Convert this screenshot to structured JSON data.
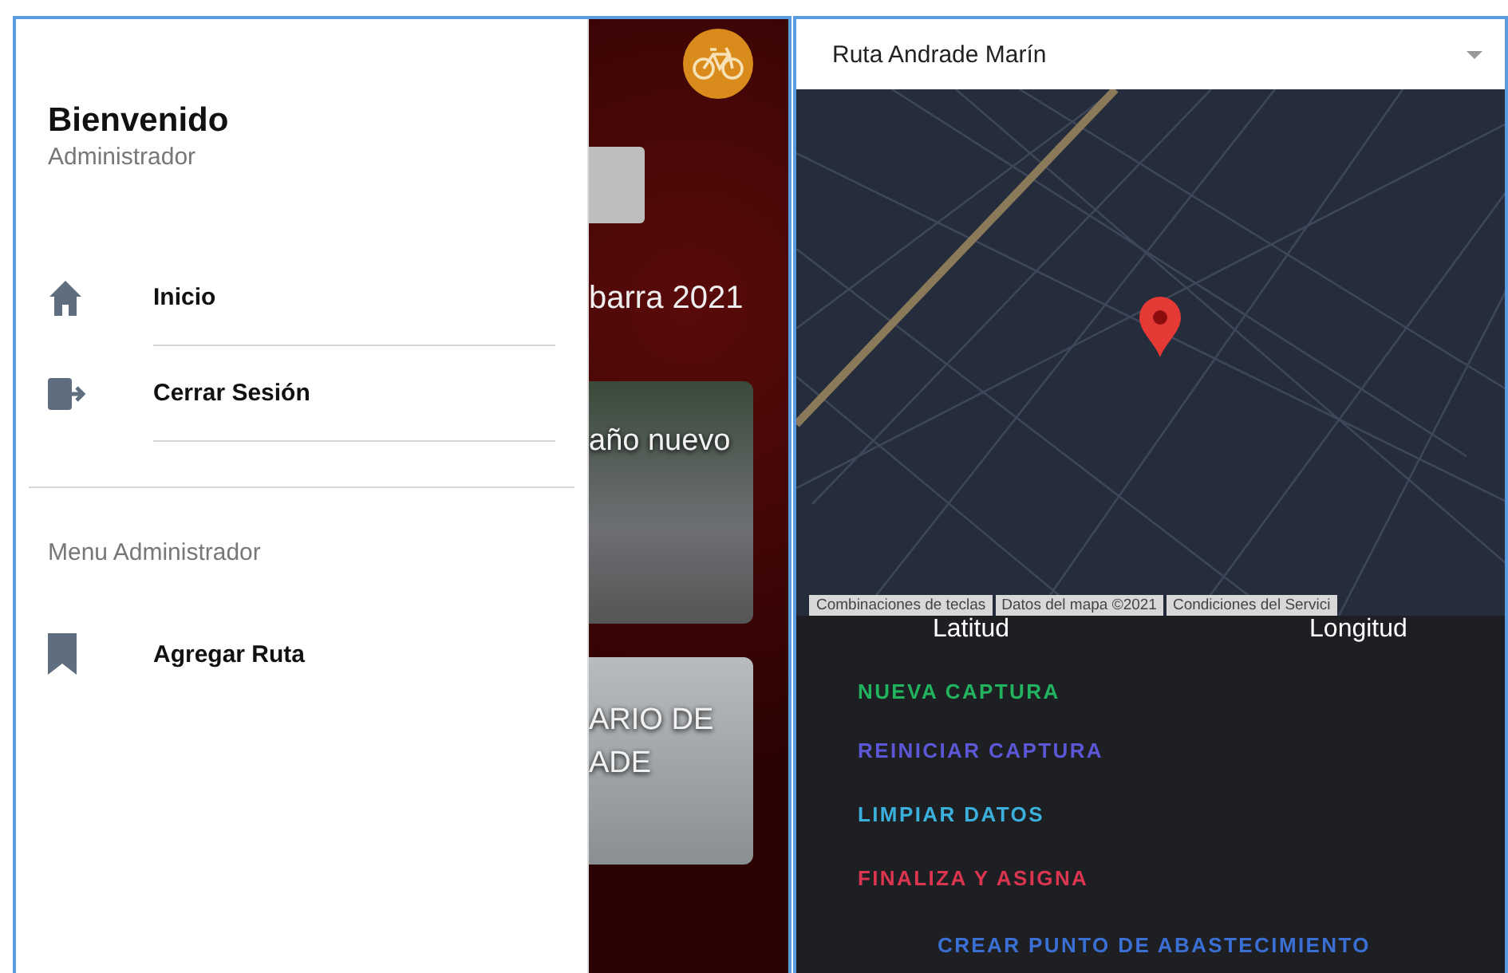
{
  "drawer": {
    "title": "Bienvenido",
    "subtitle": "Administrador",
    "items": [
      {
        "kind": "home",
        "label": "Inicio"
      },
      {
        "kind": "logout",
        "label": "Cerrar Sesión"
      }
    ],
    "section": "Menu Administrador",
    "admin_items": [
      {
        "kind": "bookmark",
        "label": "Agregar Ruta"
      }
    ]
  },
  "behind": {
    "heading": "barra 2021",
    "cards": [
      {
        "lines": [
          "año nuevo"
        ]
      },
      {
        "lines": [
          "ARIO DE",
          "ADE"
        ]
      }
    ]
  },
  "route_select": {
    "value": "Ruta Andrade Marín"
  },
  "map_attribution": [
    "Combinaciones de teclas",
    "Datos del mapa ©2021",
    "Condiciones del Servici"
  ],
  "coords": {
    "latitude_label": "Latitud",
    "longitude_label": "Longitud"
  },
  "actions": [
    {
      "label": "NUEVA CAPTURA",
      "color": "#22b35e"
    },
    {
      "label": "REINICIAR CAPTURA",
      "color": "#5b57d6"
    },
    {
      "label": "LIMPIAR DATOS",
      "color": "#3bb0dc"
    },
    {
      "label": "FINALIZA Y ASIGNA",
      "color": "#dc3550"
    }
  ],
  "main_action": {
    "label": "CREAR PUNTO DE ABASTECIMIENTO",
    "color": "#3a6fd4"
  }
}
